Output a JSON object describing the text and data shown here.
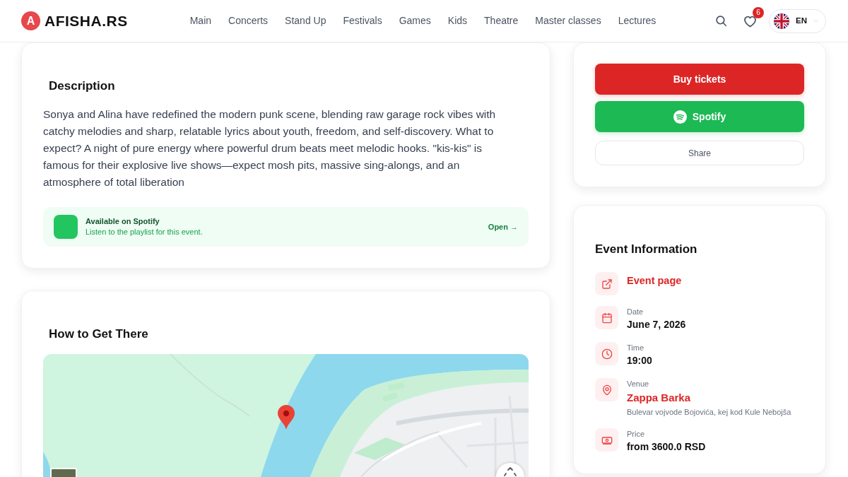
{
  "header": {
    "logo": {
      "mark": "A",
      "name": "AFISHA.RS"
    },
    "nav": [
      "Main",
      "Concerts",
      "Stand Up",
      "Festivals",
      "Games",
      "Kids",
      "Theatre",
      "Master classes",
      "Lectures"
    ],
    "favorites_count": "6",
    "language": "EN"
  },
  "description": {
    "title": "Description",
    "text": "Sonya and Alina have redefined the modern punk scene, blending raw garage rock vibes with catchy melodies and sharp, relatable lyrics about youth, freedom, and self-discovery. What to expect? A night of pure energy where powerful drum beats meet melodic hooks. \"kis-kis\" is famous for their explosive live shows—expect mosh pits, massive sing-alongs, and an atmosphere of total liberation",
    "spotify_banner": {
      "title": "Available on Spotify",
      "subtitle": "Listen to the playlist for this event.",
      "action": "Open →"
    }
  },
  "directions": {
    "title": "How to Get There"
  },
  "actions": [
    {
      "kind": "primary",
      "label": "Buy tickets"
    },
    {
      "kind": "spotify",
      "label": "Spotify"
    },
    {
      "kind": "outline",
      "label": "Share"
    }
  ],
  "event_info": {
    "title": "Event Information",
    "items": [
      {
        "kind": "link",
        "value": "Event page"
      },
      {
        "kind": "fact",
        "label": "Date",
        "value": "June 7, 2026"
      },
      {
        "kind": "fact",
        "label": "Time",
        "value": "19:00"
      },
      {
        "kind": "place",
        "label": "Venue",
        "value": "Zappa Barka",
        "address": "Bulevar vojvode Bojovića, kej kod Kule Nebojša"
      },
      {
        "kind": "fact",
        "label": "Price",
        "value": "from 3600.0 RSD"
      }
    ]
  }
}
